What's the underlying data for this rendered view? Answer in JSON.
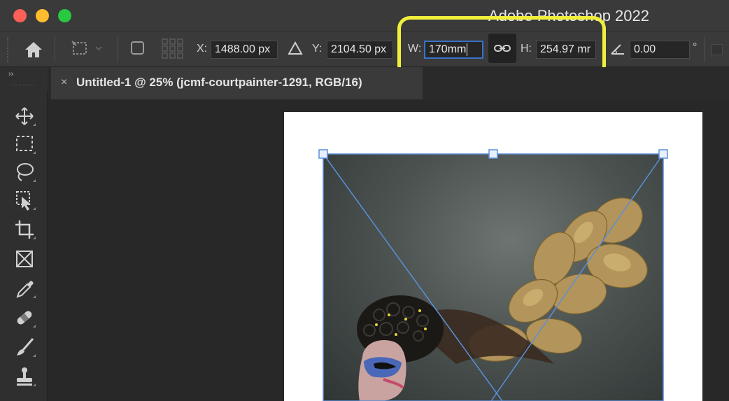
{
  "app": {
    "title": "Adobe Photoshop 2022"
  },
  "options_bar": {
    "x_label": "X:",
    "x_value": "1488.00 px",
    "y_label": "Y:",
    "y_value": "2104.50 px",
    "w_label": "W:",
    "w_value": "170mm",
    "h_label": "H:",
    "h_value": "254.97 mr",
    "angle_value": "0.00",
    "degree_symbol": "°"
  },
  "panel": {
    "collapse_label": "››"
  },
  "document_tab": {
    "close_glyph": "×",
    "title": "Untitled-1 @ 25% (jcmf-courtpainter-1291, RGB/16)"
  },
  "tools": [
    "move-tool-icon",
    "marquee-tool-icon",
    "lasso-tool-icon",
    "object-selection-tool-icon",
    "crop-tool-icon",
    "frame-tool-icon",
    "eyedropper-tool-icon",
    "healing-brush-tool-icon",
    "brush-tool-icon",
    "stamp-tool-icon"
  ],
  "colors": {
    "highlight": "#f1ef3b",
    "transform_handles": "#5b8fd9",
    "active_field_border": "#3a72c8"
  }
}
